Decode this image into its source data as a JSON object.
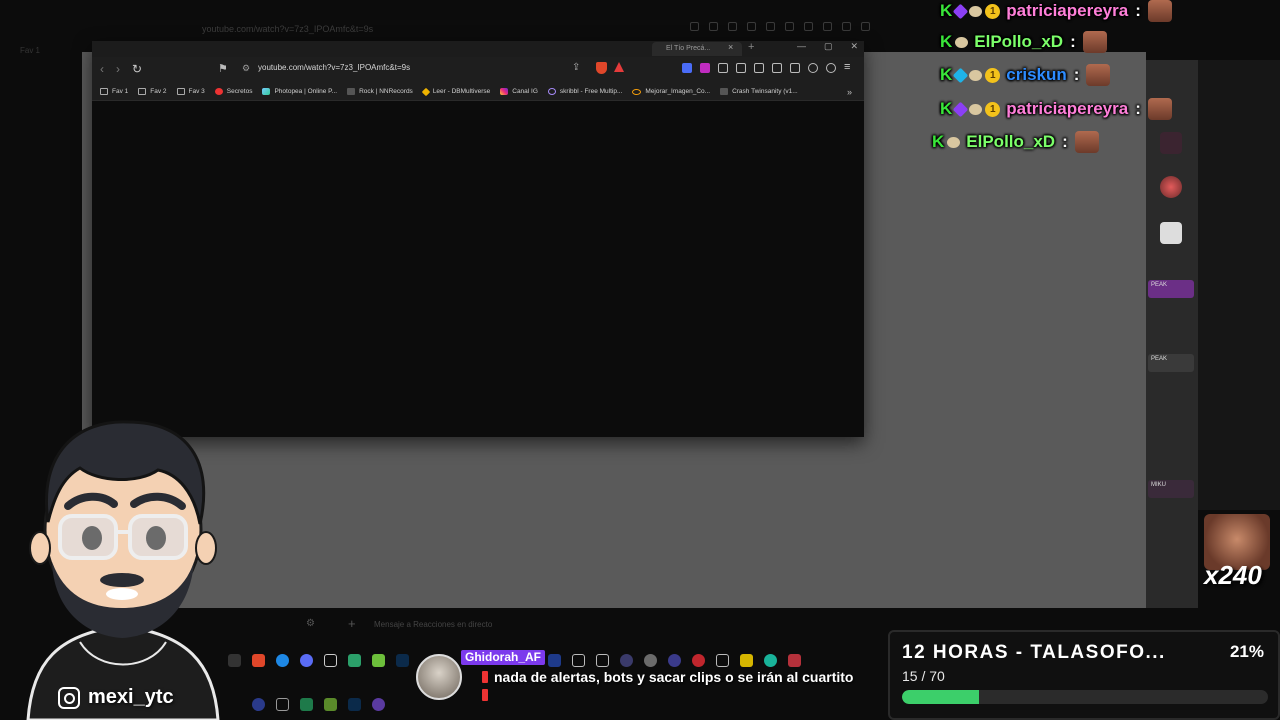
{
  "background_window": {
    "url": "youtube.com/watch?v=7z3_IPOAmfc&t=9s",
    "fav_label": "Fav 1"
  },
  "browser": {
    "tab_title": "El Tío Precá...",
    "url": "youtube.com/watch?v=7z3_IPOAmfc&t=9s",
    "bookmarks": [
      {
        "label": "Fav 1",
        "icon": "folder-icon"
      },
      {
        "label": "Fav 2",
        "icon": "folder-icon"
      },
      {
        "label": "Fav 3",
        "icon": "folder-icon"
      },
      {
        "label": "Secretos",
        "icon": "red-dot-icon"
      },
      {
        "label": "Photopea | Online P...",
        "icon": "photopea-icon"
      },
      {
        "label": "Rock | NNRecords",
        "icon": "page-icon"
      },
      {
        "label": "Leer - DBMultiverse",
        "icon": "dragonball-icon"
      },
      {
        "label": "Canal IG",
        "icon": "instagram-icon"
      },
      {
        "label": "skribbl - Free Multip...",
        "icon": "pen-icon"
      },
      {
        "label": "Mejorar_Imagen_Co...",
        "icon": "glasses-icon"
      },
      {
        "label": "Crash Twinsanity (v1...",
        "icon": "game-icon"
      }
    ]
  },
  "chat": [
    {
      "user": "patriciapereyra",
      "color": "#ff7fd9",
      "badges": [
        "k",
        "purple-gem",
        "mouse",
        "coin"
      ]
    },
    {
      "user": "ElPollo_xD",
      "color": "#7cff6a",
      "badges": [
        "k",
        "mouse"
      ]
    },
    {
      "user": "criskun",
      "color": "#2d8cff",
      "badges": [
        "k",
        "blue-gem",
        "mouse",
        "coin"
      ]
    },
    {
      "user": "patriciapereyra",
      "color": "#ff7fd9",
      "badges": [
        "k",
        "purple-gem",
        "mouse",
        "coin"
      ]
    },
    {
      "user": "ElPollo_xD",
      "color": "#7cff6a",
      "badges": [
        "k",
        "mouse"
      ]
    }
  ],
  "chat_separator": ":",
  "coin_badge_text": "1",
  "emote_counter": "x240",
  "streamer": {
    "instagram": "mexi_ytc"
  },
  "alert": {
    "user": "Ghidorah_AF",
    "message": "nada de alertas, bots y sacar clips o se irán al cuartito"
  },
  "goal": {
    "title": "12 HORAS - TALASOFO...",
    "percent_text": "21%",
    "count_text": "15 / 70",
    "progress": 0.21,
    "color": "#3ccf6a"
  },
  "desk_tags": [
    "PEAK",
    "PEAK",
    "MIKU"
  ],
  "chat_input_placeholder": "Mensaje a   Reacciones en directo"
}
